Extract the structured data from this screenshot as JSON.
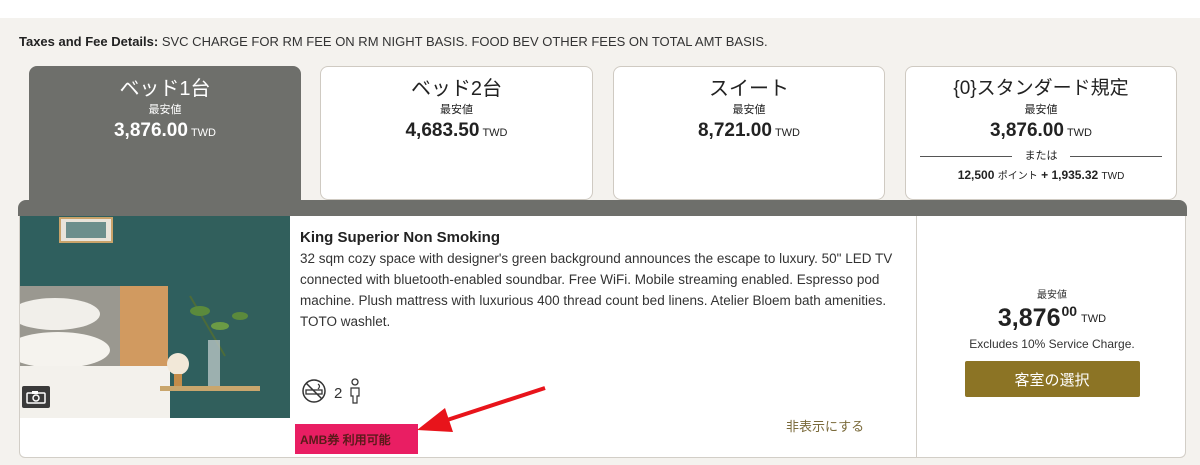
{
  "tax": {
    "label": "Taxes and Fee Details:",
    "text": "SVC CHARGE FOR RM FEE ON RM NIGHT BASIS. FOOD BEV OTHER FEES ON TOTAL AMT BASIS."
  },
  "tabs": [
    {
      "name": "ベッド1台",
      "label": "最安値",
      "price": "3,876.00",
      "currency": "TWD",
      "active": true
    },
    {
      "name": "ベッド2台",
      "label": "最安値",
      "price": "4,683.50",
      "currency": "TWD"
    },
    {
      "name": "スイート",
      "label": "最安値",
      "price": "8,721.00",
      "currency": "TWD"
    },
    {
      "name": "{0}スタンダード規定",
      "label": "最安値",
      "price": "3,876.00",
      "currency": "TWD",
      "or_text": "または",
      "points": "12,500",
      "points_label": "ポイント",
      "plus": "+",
      "points_cash": "1,935.32",
      "points_currency": "TWD"
    }
  ],
  "room": {
    "title": "King Superior Non Smoking",
    "description": "32 sqm cozy space with designer's green background announces the escape to luxury. 50\" LED TV connected with bluetooth-enabled soundbar. Free WiFi. Mobile streaming enabled. Espresso pod machine. Plush mattress with luxurious 400 thread count bed linens. Atelier Bloem bath amenities. TOTO washlet.",
    "occupancy": "2",
    "hide_link": "非表示にする",
    "amb_badge": "AMB券 利用可能"
  },
  "price": {
    "label": "最安値",
    "integer": "3,876",
    "decimal": "00",
    "currency": "TWD",
    "note": "Excludes 10% Service Charge.",
    "select_button": "客室の選択"
  },
  "colors": {
    "active_tab": "#6e6f6b",
    "select_button": "#8c7425",
    "badge": "#e91e63",
    "arrow": "#e8141b"
  },
  "icons": [
    "no-smoking-icon",
    "person-icon",
    "camera-icon"
  ]
}
